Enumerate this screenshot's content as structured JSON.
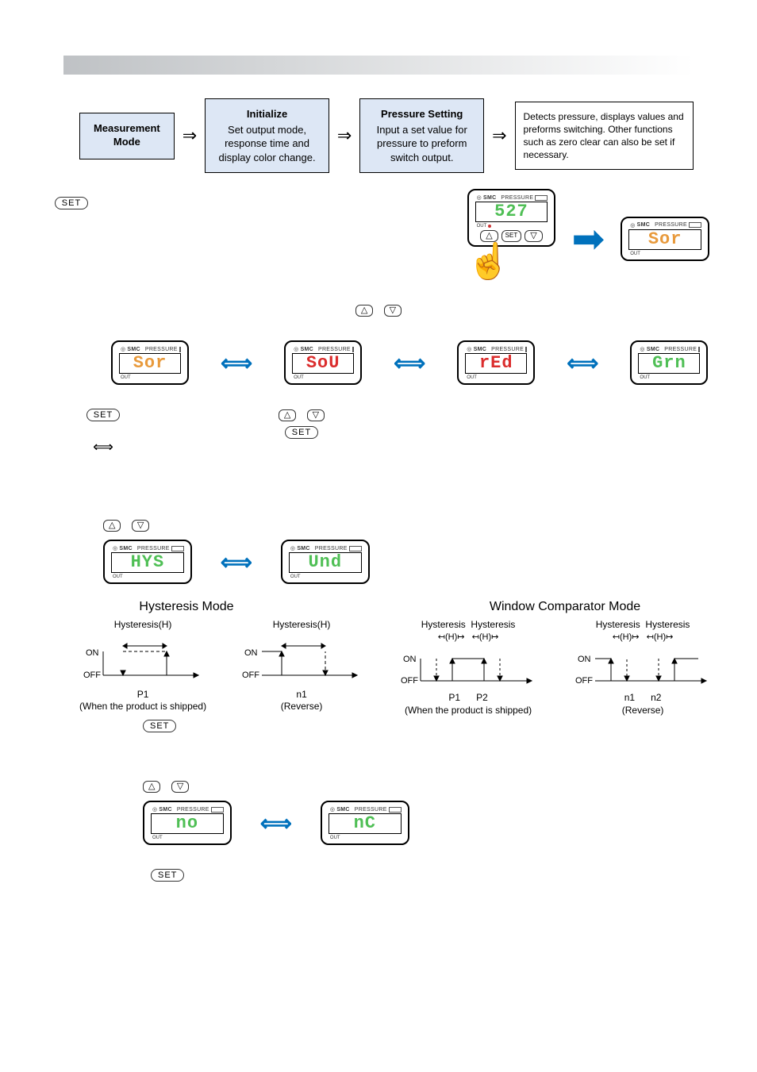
{
  "header_bar": "",
  "flow": {
    "measurement": {
      "title": "Measurement Mode"
    },
    "initialize": {
      "title": "Initialize",
      "body": "Set output mode, response time and display color change."
    },
    "pressure": {
      "title": "Pressure Setting",
      "body": "Input a set value for pressure to preform switch output."
    },
    "note": {
      "body": "Detects pressure, displays values and preforms switching. Other functions such as zero clear can also be set if necessary."
    }
  },
  "buttons": {
    "set": "SET",
    "up": "△",
    "down": "▽"
  },
  "device": {
    "brand": "SMC",
    "label": "PRESSURE",
    "out": "OUT"
  },
  "displays": {
    "measured": "527",
    "sor": "Sor",
    "sou": "SoU",
    "red": "rEd",
    "grn": "Grn",
    "hys": "HYS",
    "und": "Und",
    "no": "no",
    "nc": "nC"
  },
  "modes": {
    "hysteresis_title": "Hysteresis Mode",
    "window_title": "Window Comparator Mode",
    "hysteresis_label": "Hysteresis(H)",
    "hysteresis_short": "(H)",
    "hysteresis_word": "Hysteresis",
    "on": "ON",
    "off": "OFF",
    "p1": "P1",
    "p2": "P2",
    "n1": "n1",
    "n2": "n2",
    "shipped": "(When the product is shipped)",
    "reverse": "(Reverse)"
  }
}
